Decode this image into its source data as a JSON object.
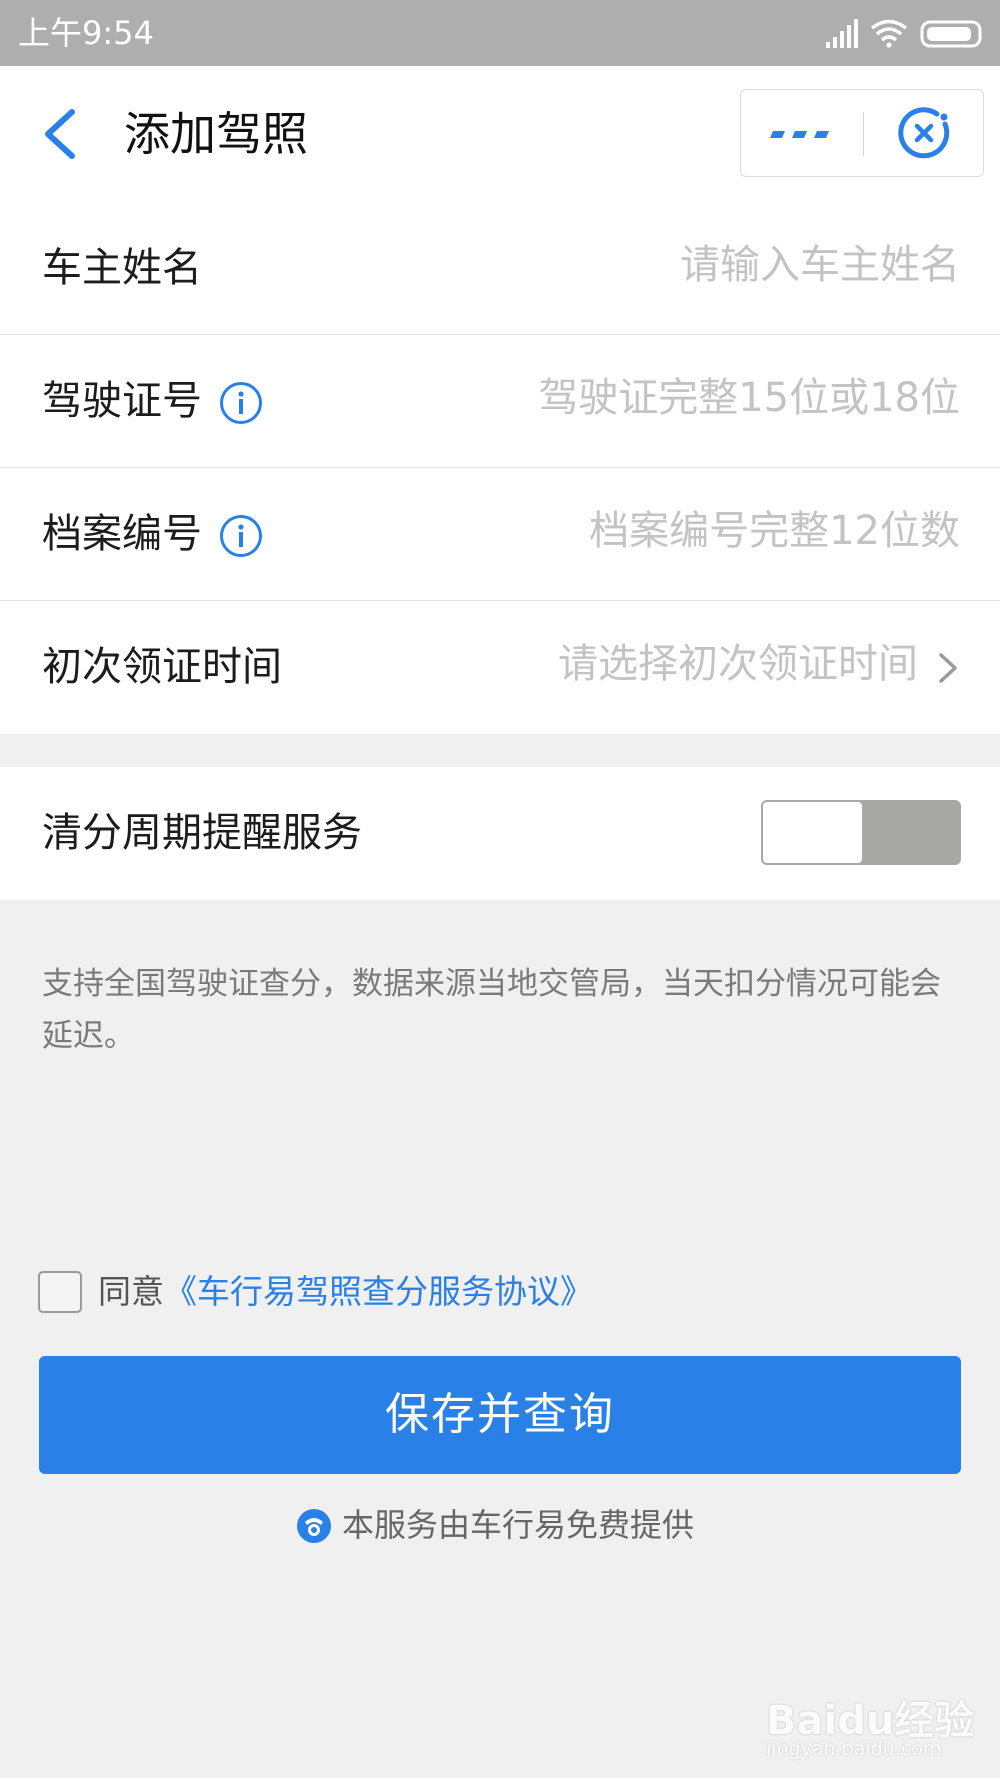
{
  "status_bar": {
    "time": "上午9:54"
  },
  "nav": {
    "title": "添加驾照"
  },
  "form": {
    "rows": [
      {
        "label": "车主姓名",
        "placeholder": "请输入车主姓名"
      },
      {
        "label": "驾驶证号",
        "placeholder": "驾驶证完整15位或18位",
        "has_info": true
      },
      {
        "label": "档案编号",
        "placeholder": "档案编号完整12位数",
        "has_info": true
      },
      {
        "label": "初次领证时间",
        "placeholder": "请选择初次领证时间",
        "has_chevron": true
      }
    ]
  },
  "reminder": {
    "label": "清分周期提醒服务",
    "enabled": false
  },
  "notice": "支持全国驾驶证查分，数据来源当地交管局，当天扣分情况可能会延迟。",
  "agreement": {
    "prefix": "同意",
    "link": "《车行易驾照查分服务协议》",
    "checked": false
  },
  "submit_label": "保存并查询",
  "provider_text": "本服务由车行易免费提供",
  "watermark": {
    "brand": "Baidu经验",
    "url": "jingyan.baidu.com"
  },
  "colors": {
    "accent": "#2980e7",
    "statusbar": "#aeaeae",
    "background": "#f0f0f0"
  },
  "icons": [
    "back-arrow-icon",
    "more-dots-icon",
    "close-circle-icon",
    "info-icon",
    "chevron-right-icon",
    "signal-icon",
    "wifi-icon",
    "battery-icon",
    "provider-logo-icon"
  ]
}
